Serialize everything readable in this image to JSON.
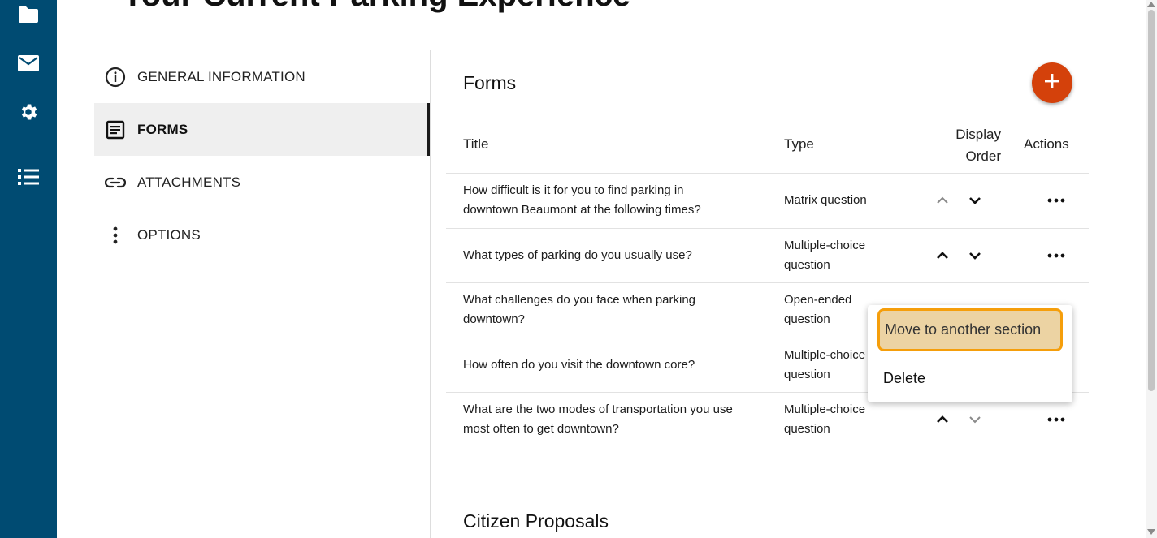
{
  "page": {
    "title": "Your Current Parking Experience"
  },
  "rail": {
    "icons": [
      "folder-icon",
      "mail-icon",
      "gear-icon",
      "list-icon"
    ],
    "color": "#004b72"
  },
  "nav": {
    "items": [
      {
        "label": "GENERAL INFORMATION",
        "icon": "info-icon",
        "active": false
      },
      {
        "label": "FORMS",
        "icon": "form-icon",
        "active": true
      },
      {
        "label": "ATTACHMENTS",
        "icon": "link-icon",
        "active": false
      },
      {
        "label": "OPTIONS",
        "icon": "more-vertical-icon",
        "active": false
      }
    ]
  },
  "forms": {
    "heading": "Forms",
    "add_button_color": "#d4410b",
    "columns": {
      "title": "Title",
      "type": "Type",
      "display_order": "Display Order",
      "actions": "Actions"
    },
    "rows": [
      {
        "title": "How difficult is it for you to find parking in downtown Beaumont at the following times?",
        "type": "Matrix question",
        "up_enabled": false,
        "down_enabled": true
      },
      {
        "title": "What types of parking do you usually use?",
        "type": "Multiple-choice question",
        "up_enabled": true,
        "down_enabled": true
      },
      {
        "title": "What challenges do you face when parking downtown?",
        "type": "Open-ended question",
        "up_enabled": true,
        "down_enabled": true
      },
      {
        "title": "How often do you visit the downtown core?",
        "type": "Multiple-choice question",
        "up_enabled": true,
        "down_enabled": true
      },
      {
        "title": "What are the two modes of transportation you use most often to get downtown?",
        "type": "Multiple-choice question",
        "up_enabled": true,
        "down_enabled": false
      }
    ]
  },
  "menu": {
    "items": [
      "Move to another section",
      "Delete"
    ],
    "highlight_color": "#ecd3a3",
    "highlight_border": "#f59e0b"
  },
  "section2": {
    "heading": "Citizen Proposals"
  }
}
